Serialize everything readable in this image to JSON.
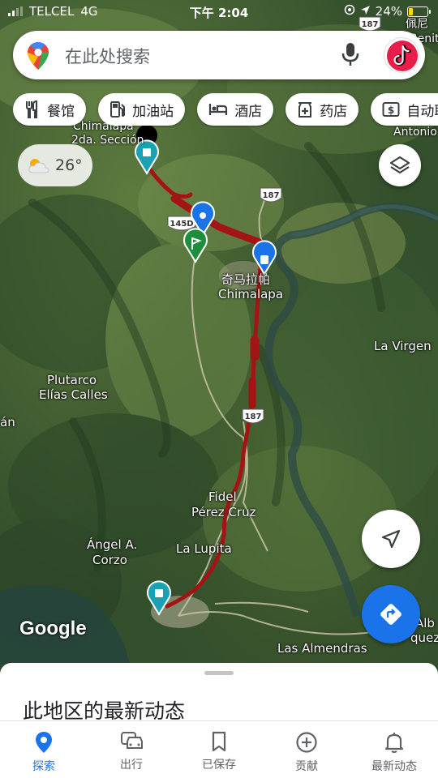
{
  "status_bar": {
    "carrier": "TELCEL",
    "network": "4G",
    "time": "下午 2:04",
    "battery_percent": "24%",
    "battery_level": 0.24
  },
  "search": {
    "placeholder": "在此处搜索"
  },
  "chips": [
    {
      "icon": "restaurant-icon",
      "label": "餐馆"
    },
    {
      "icon": "gas-station-icon",
      "label": "加油站"
    },
    {
      "icon": "hotel-icon",
      "label": "酒店"
    },
    {
      "icon": "pharmacy-icon",
      "label": "药店"
    },
    {
      "icon": "atm-icon",
      "label": "自动取"
    }
  ],
  "weather": {
    "icon": "partly-cloudy-icon",
    "temperature": "26°"
  },
  "map": {
    "route_color": "#a31515",
    "marker_color": "#1a73e8",
    "flag_color": "#1e8e3e",
    "labels": {
      "chimalapa_small": "Chimalapa",
      "seccion": "2da. Sección",
      "antonio": "Antonio",
      "top_right": "佩尼",
      "top_right_2": "Benit",
      "chimalapa_cn": "奇马拉帕",
      "chimalapa": "Chimalapa",
      "la_virgen": "La Virgen",
      "plutarco": "Plutarco",
      "elias_calles": "Elías Calles",
      "left_edge": "án",
      "fidel": "Fidel",
      "perez_cruz": "Pérez Cruz",
      "angel": "Ángel A.",
      "corzo": "Corzo",
      "la_lupita": "La Lupita",
      "las_almendras": "Las Almendras",
      "right_alb": "Alb",
      "right_quez": "quez"
    },
    "road_shields": [
      "187",
      "145D",
      "187",
      "187"
    ]
  },
  "google_logo": "Google",
  "sheet": {
    "title": "此地区的最新动态"
  },
  "nav": [
    {
      "icon": "explore-pin-icon",
      "label": "探索",
      "active": true
    },
    {
      "icon": "commute-car-icon",
      "label": "出行",
      "active": false
    },
    {
      "icon": "bookmark-icon",
      "label": "已保存",
      "active": false
    },
    {
      "icon": "add-circle-icon",
      "label": "贡献",
      "active": false
    },
    {
      "icon": "bell-icon",
      "label": "最新动态",
      "active": false
    }
  ]
}
